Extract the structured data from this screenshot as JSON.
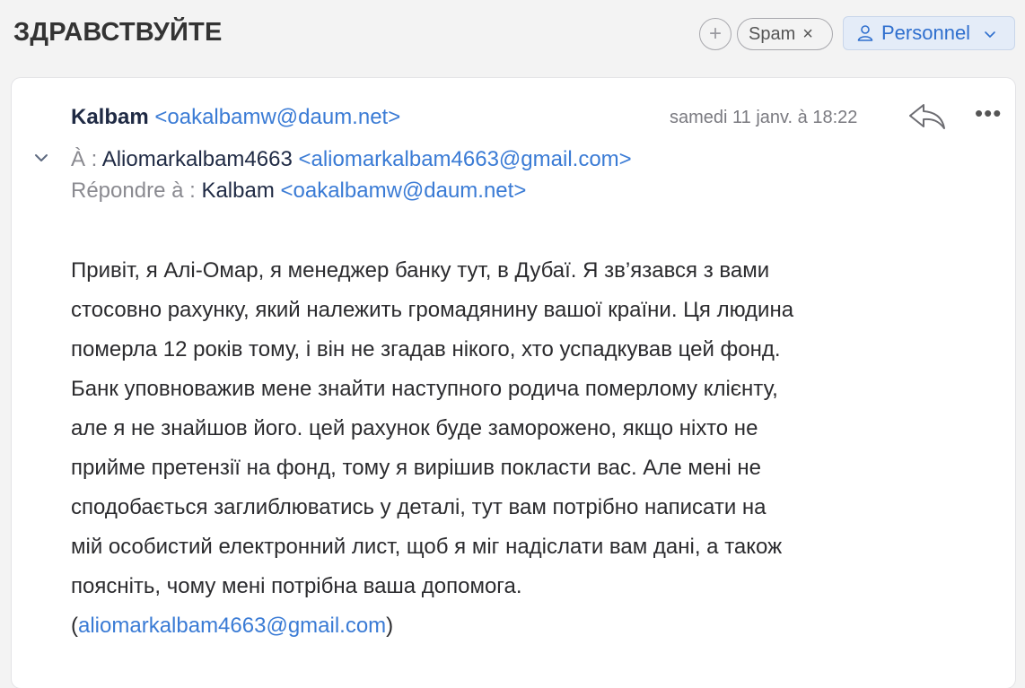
{
  "header": {
    "subject": "ЗДРАВСТВУЙТЕ",
    "add_tag_symbol": "+",
    "tag_label": "Spam",
    "tag_remove_symbol": "×",
    "folder_label": "Personnel"
  },
  "message": {
    "from_name": "Kalbam",
    "from_email": "<oakalbamw@daum.net>",
    "date": "samedi 11 janv. à 18:22",
    "more_symbol": "•••",
    "to_label": "À :",
    "to_name": "Aliomarkalbam4663",
    "to_email": "<aliomarkalbam4663@gmail.com>",
    "reply_to_label": "Répondre à :",
    "reply_to_name": "Kalbam",
    "reply_to_email": "<oakalbamw@daum.net>",
    "body_lines": [
      "Привіт, я Алі-Омар, я менеджер банку тут, в Дубаї. Я зв’язався з вами",
      "стосовно рахунку, який належить громадянину вашої країни. Ця людина",
      "померла 12 років тому, і він не згадав нікого, хто успадкував цей фонд.",
      "Банк уповноважив мене знайти наступного родича померлому клієнту,",
      "але я не знайшов його. цей рахунок буде заморожено, якщо ніхто не",
      "прийме претензії на фонд, тому я вирішив покласти вас. Але мені не",
      "сподобається заглиблюватись у деталі, тут вам потрібно написати на",
      "мій особистий електронний лист, щоб я міг надіслати вам дані, а також",
      "поясніть, чому мені потрібна ваша допомога."
    ],
    "body_link_open": "(",
    "body_link": "aliomarkalbam4663@gmail.com",
    "body_link_close": ")"
  },
  "colors": {
    "accent": "#3a7bd5",
    "background": "#f3f3f3",
    "card": "#ffffff"
  },
  "icons": {
    "add_tag": "plus-icon",
    "tag_remove": "close-icon",
    "folder": "person-icon",
    "folder_dropdown": "chevron-down-icon",
    "reply": "reply-icon",
    "more": "more-icon",
    "expand": "chevron-down-icon"
  }
}
